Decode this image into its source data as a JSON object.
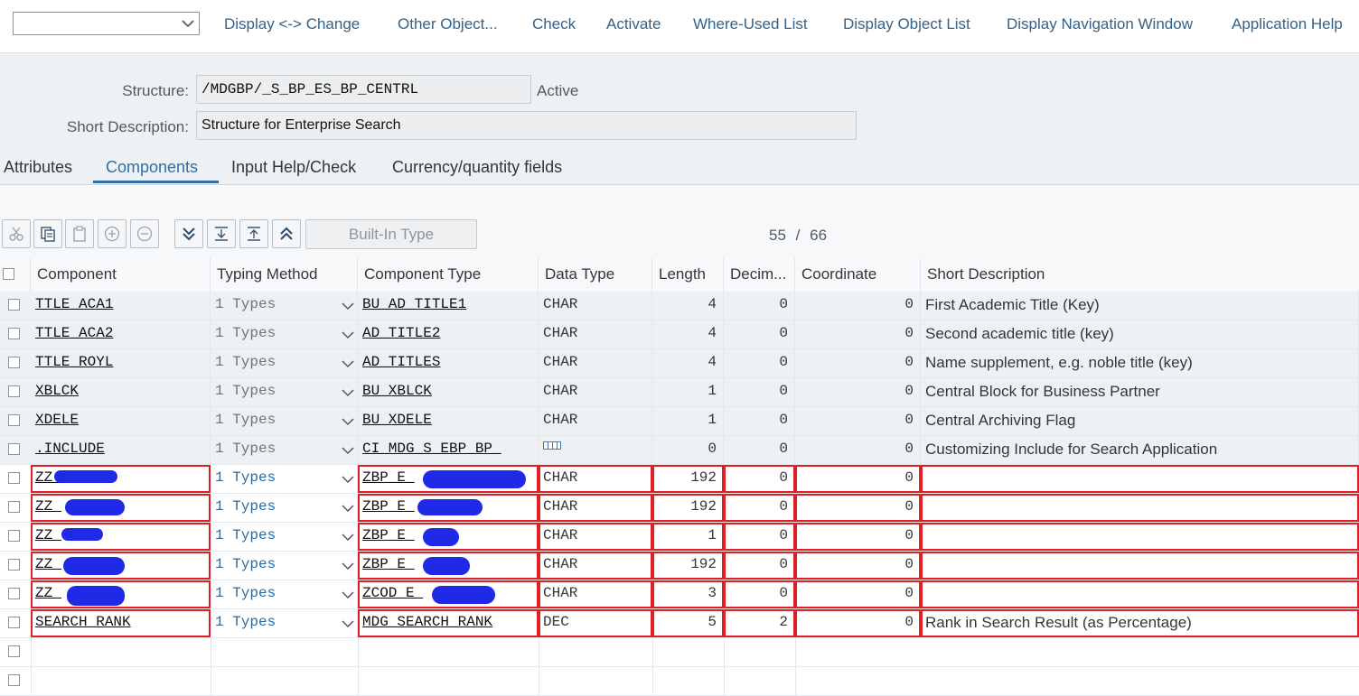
{
  "toolbar": {
    "buttons": [
      "Display <-> Change",
      "Other Object...",
      "Check",
      "Activate",
      "Where-Used List",
      "Display Object List",
      "Display Navigation Window",
      "Application Help"
    ]
  },
  "header": {
    "structure_label": "Structure:",
    "structure_value": "/MDGBP/_S_BP_ES_BP_CENTRL",
    "status": "Active",
    "short_desc_label": "Short Description:",
    "short_desc_value": "Structure for Enterprise Search"
  },
  "tabs": [
    "Attributes",
    "Components",
    "Input Help/Check",
    "Currency/quantity fields"
  ],
  "table_toolbar": {
    "builtin_type_label": "Built-In Type",
    "current": "55",
    "separator": "/",
    "total": "66"
  },
  "table": {
    "columns": [
      "Component",
      "Typing Method",
      "Component Type",
      "Data Type",
      "Length",
      "Decim...",
      "Coordinate",
      "Short Description"
    ],
    "rows": [
      {
        "component": "TTLE_ACA1",
        "typing": "1 Types",
        "comp_type": "BU_AD_TITLE1",
        "data_type": "CHAR",
        "length": "4",
        "decimals": "0",
        "coordinate": "0",
        "short_desc": "First Academic Title (Key)"
      },
      {
        "component": "TTLE_ACA2",
        "typing": "1 Types",
        "comp_type": "AD_TITLE2",
        "data_type": "CHAR",
        "length": "4",
        "decimals": "0",
        "coordinate": "0",
        "short_desc": "Second academic title (key)"
      },
      {
        "component": "TTLE_ROYL",
        "typing": "1 Types",
        "comp_type": "AD_TITLES",
        "data_type": "CHAR",
        "length": "4",
        "decimals": "0",
        "coordinate": "0",
        "short_desc": "Name supplement, e.g. noble title (key)"
      },
      {
        "component": "XBLCK",
        "typing": "1 Types",
        "comp_type": "BU_XBLCK",
        "data_type": "CHAR",
        "length": "1",
        "decimals": "0",
        "coordinate": "0",
        "short_desc": "Central Block for Business Partner"
      },
      {
        "component": "XDELE",
        "typing": "1 Types",
        "comp_type": "BU_XDELE",
        "data_type": "CHAR",
        "length": "1",
        "decimals": "0",
        "coordinate": "0",
        "short_desc": "Central Archiving Flag"
      },
      {
        "component": ".INCLUDE",
        "typing": "1 Types",
        "comp_type": "CI_MDG_S_EBP_BP_",
        "data_type": "",
        "length": "0",
        "decimals": "0",
        "coordinate": "0",
        "short_desc": "Customizing Include for Search Application"
      },
      {
        "component": "ZZ_",
        "typing": "1 Types",
        "comp_type": "ZBP_E_",
        "data_type": "CHAR",
        "length": "192",
        "decimals": "0",
        "coordinate": "0",
        "short_desc": ""
      },
      {
        "component": "ZZ_",
        "typing": "1 Types",
        "comp_type": "ZBP_E_",
        "data_type": "CHAR",
        "length": "192",
        "decimals": "0",
        "coordinate": "0",
        "short_desc": ""
      },
      {
        "component": "ZZ_",
        "typing": "1 Types",
        "comp_type": "ZBP_E_",
        "data_type": "CHAR",
        "length": "1",
        "decimals": "0",
        "coordinate": "0",
        "short_desc": ""
      },
      {
        "component": "ZZ_",
        "typing": "1 Types",
        "comp_type": "ZBP_E_",
        "data_type": "CHAR",
        "length": "192",
        "decimals": "0",
        "coordinate": "0",
        "short_desc": ""
      },
      {
        "component": "ZZ_",
        "typing": "1 Types",
        "comp_type": "ZCOD_E_",
        "data_type": "CHAR",
        "length": "3",
        "decimals": "0",
        "coordinate": "0",
        "short_desc": ""
      },
      {
        "component": "SEARCH_RANK",
        "typing": "1 Types",
        "comp_type": "MDG_SEARCH_RANK",
        "data_type": "DEC",
        "length": "5",
        "decimals": "2",
        "coordinate": "0",
        "short_desc": "Rank in Search Result (as Percentage)"
      }
    ]
  },
  "colors": {
    "link_blue": "#346187",
    "tab_active": "#2e6fa5",
    "highlight_red": "#e01f26",
    "redaction_blue": "#1f2ae6"
  }
}
